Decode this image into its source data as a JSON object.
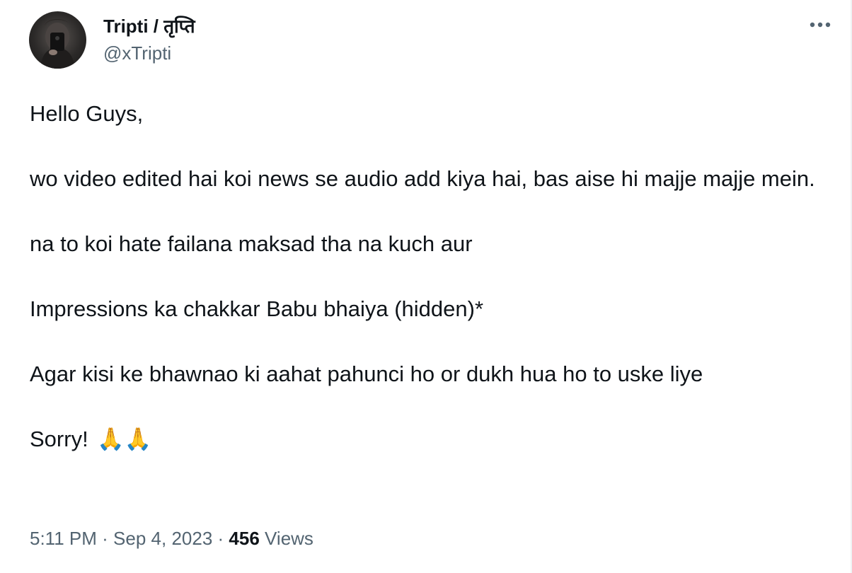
{
  "author": {
    "display_name": "Tripti / तृप्ति",
    "handle": "@xTripti"
  },
  "icons": {
    "more": "more-horizontal-icon",
    "avatar": "profile-photo"
  },
  "tweet": {
    "paragraphs": [
      "Hello Guys,",
      "wo video edited hai koi news se audio add kiya hai, bas aise hi majje majje mein.",
      "na to koi hate failana maksad tha na kuch aur",
      "Impressions ka chakkar Babu bhaiya (hidden)*",
      "Agar kisi ke bhawnao ki aahat pahunci ho or dukh hua ho to uske liye"
    ],
    "closing_text": "Sorry!",
    "closing_emoji": "🙏🙏"
  },
  "meta": {
    "time": "5:11 PM",
    "separator": "·",
    "date": "Sep 4, 2023",
    "views_count": "456",
    "views_label": "Views"
  },
  "colors": {
    "text_primary": "#0f1419",
    "text_secondary": "#536471",
    "border": "#eff3f4"
  }
}
